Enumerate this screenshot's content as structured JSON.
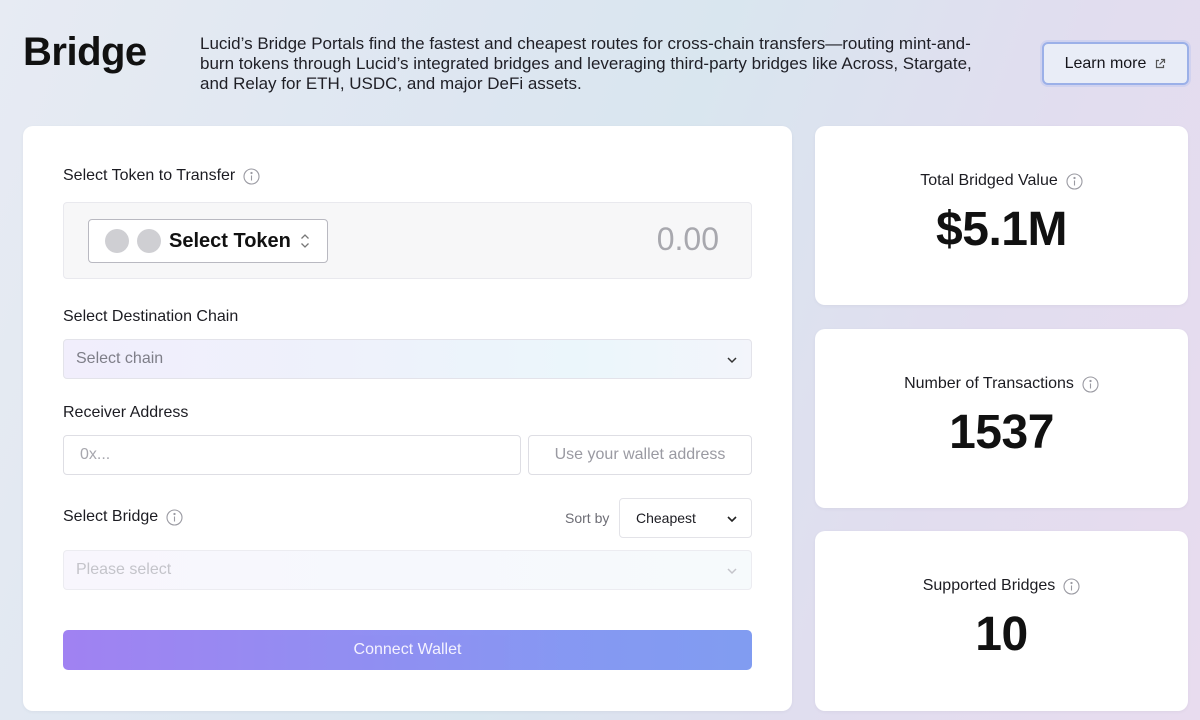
{
  "header": {
    "title": "Bridge",
    "description": "Lucid’s Bridge Portals find the fastest and cheapest routes for cross-chain transfers—routing mint-and-burn tokens through Lucid’s integrated bridges and leveraging third-party bridges like Across, Stargate, and Relay for ETH, USDC, and major DeFi assets.",
    "learn_more_label": "Learn more",
    "learn_more_icon": "external-link-icon"
  },
  "form": {
    "token_section_label": "Select Token to Transfer",
    "token_select_label": "Select Token",
    "amount": "0.00",
    "destination_label": "Select Destination Chain",
    "destination_placeholder": "Select chain",
    "receiver_label": "Receiver Address",
    "receiver_placeholder": "0x...",
    "use_wallet_label": "Use your wallet address",
    "bridge_label": "Select Bridge",
    "sort_by_label": "Sort by",
    "sort_selected": "Cheapest",
    "bridge_placeholder": "Please select",
    "connect_wallet_label": "Connect Wallet"
  },
  "stats": [
    {
      "label": "Total Bridged Value",
      "value": "$5.1M"
    },
    {
      "label": "Number of Transactions",
      "value": "1537"
    },
    {
      "label": "Supported Bridges",
      "value": "10"
    }
  ],
  "colors": {
    "button_gradient_start": "#9b7bf1",
    "button_gradient_end": "#7a97f0",
    "learn_more_border": "#9bb0e8"
  }
}
